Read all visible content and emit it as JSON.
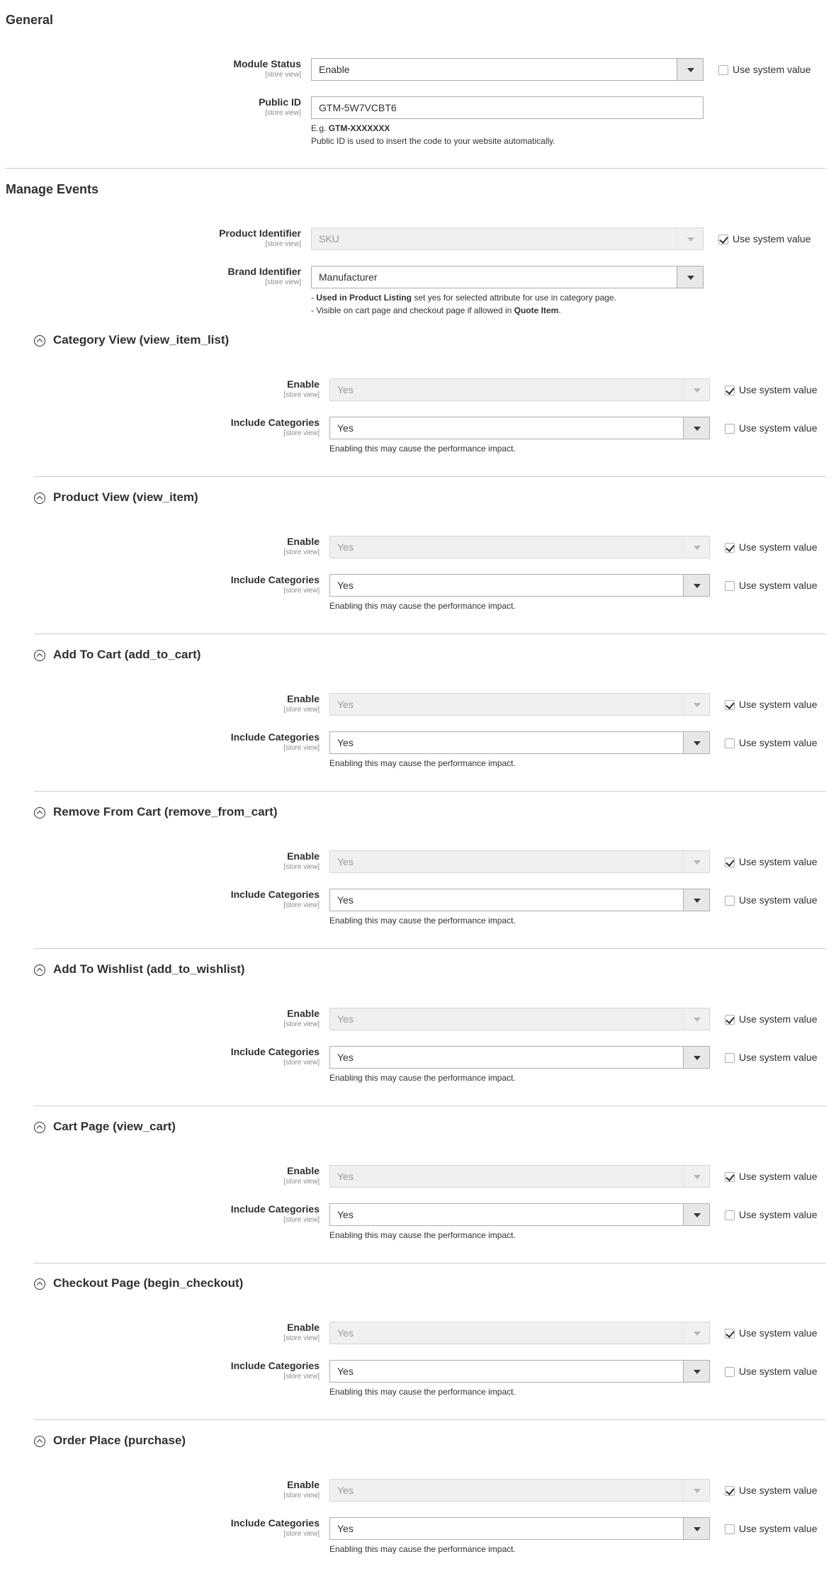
{
  "general": {
    "title": "General",
    "module_status": {
      "label": "Module Status",
      "scope": "[store view]",
      "value": "Enable",
      "use_system_label": "Use system value",
      "use_system_checked": false
    },
    "public_id": {
      "label": "Public ID",
      "scope": "[store view]",
      "value": "GTM-5W7VCBT6",
      "example_prefix": "E.g. ",
      "example_value": "GTM-XXXXXXX",
      "note": "Public ID is used to insert the code to your website automatically."
    }
  },
  "manage_events": {
    "title": "Manage Events",
    "product_identifier": {
      "label": "Product Identifier",
      "scope": "[store view]",
      "value": "SKU",
      "use_system_label": "Use system value",
      "use_system_checked": true
    },
    "brand_identifier": {
      "label": "Brand Identifier",
      "scope": "[store view]",
      "value": "Manufacturer",
      "note1_prefix": "- ",
      "note1_bold": "Used in Product Listing",
      "note1_rest": " set yes for selected attribute for use in category page.",
      "note2_prefix": "- Visible on cart page and checkout page if allowed in ",
      "note2_bold": "Quote Item",
      "note2_suffix": "."
    }
  },
  "groups": [
    {
      "title": "Category View (view_item_list)",
      "enable_label": "Enable",
      "enable_scope": "[store view]",
      "enable_value": "Yes",
      "include_label": "Include Categories",
      "include_scope": "[store view]",
      "include_value": "Yes",
      "use_system_label": "Use system value",
      "note": "Enabling this may cause the performance impact."
    },
    {
      "title": "Product View (view_item)",
      "enable_label": "Enable",
      "enable_scope": "[store view]",
      "enable_value": "Yes",
      "include_label": "Include Categories",
      "include_scope": "[store view]",
      "include_value": "Yes",
      "use_system_label": "Use system value",
      "note": "Enabling this may cause the performance impact."
    },
    {
      "title": "Add To Cart (add_to_cart)",
      "enable_label": "Enable",
      "enable_scope": "[store view]",
      "enable_value": "Yes",
      "include_label": "Include Categories",
      "include_scope": "[store view]",
      "include_value": "Yes",
      "use_system_label": "Use system value",
      "note": "Enabling this may cause the performance impact."
    },
    {
      "title": "Remove From Cart (remove_from_cart)",
      "enable_label": "Enable",
      "enable_scope": "[store view]",
      "enable_value": "Yes",
      "include_label": "Include Categories",
      "include_scope": "[store view]",
      "include_value": "Yes",
      "use_system_label": "Use system value",
      "note": "Enabling this may cause the performance impact."
    },
    {
      "title": "Add To Wishlist (add_to_wishlist)",
      "enable_label": "Enable",
      "enable_scope": "[store view]",
      "enable_value": "Yes",
      "include_label": "Include Categories",
      "include_scope": "[store view]",
      "include_value": "Yes",
      "use_system_label": "Use system value",
      "note": "Enabling this may cause the performance impact."
    },
    {
      "title": "Cart Page (view_cart)",
      "enable_label": "Enable",
      "enable_scope": "[store view]",
      "enable_value": "Yes",
      "include_label": "Include Categories",
      "include_scope": "[store view]",
      "include_value": "Yes",
      "use_system_label": "Use system value",
      "note": "Enabling this may cause the performance impact."
    },
    {
      "title": "Checkout Page (begin_checkout)",
      "enable_label": "Enable",
      "enable_scope": "[store view]",
      "enable_value": "Yes",
      "include_label": "Include Categories",
      "include_scope": "[store view]",
      "include_value": "Yes",
      "use_system_label": "Use system value",
      "note": "Enabling this may cause the performance impact."
    },
    {
      "title": "Order Place (purchase)",
      "enable_label": "Enable",
      "enable_scope": "[store view]",
      "enable_value": "Yes",
      "include_label": "Include Categories",
      "include_scope": "[store view]",
      "include_value": "Yes",
      "use_system_label": "Use system value",
      "note": "Enabling this may cause the performance impact."
    }
  ]
}
